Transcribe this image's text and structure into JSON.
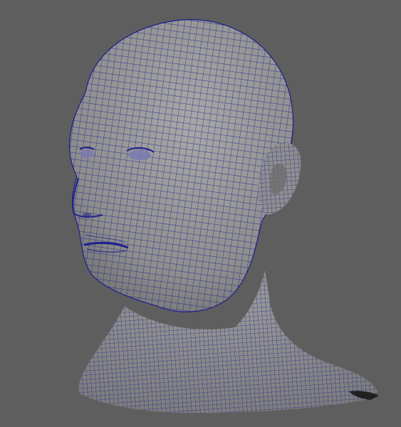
{
  "viewport": {
    "background_color": "#5e5e5e",
    "wireframe_color": "#1e1e8c",
    "surface_color": "#9a9a9a",
    "shadow_color": "#202020"
  },
  "model": {
    "parts": [
      "head",
      "ear",
      "neck-and-shoulders",
      "eyes",
      "nose",
      "mouth"
    ]
  }
}
